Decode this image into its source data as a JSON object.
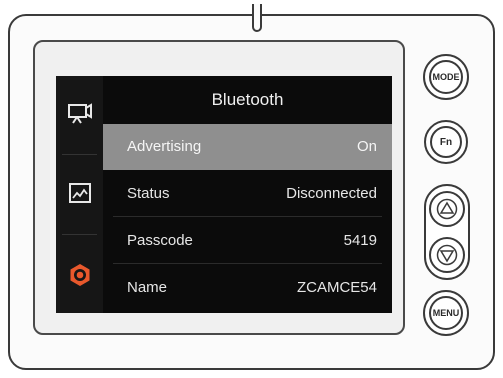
{
  "screen": {
    "title": "Bluetooth",
    "rows": [
      {
        "label": "Advertising",
        "value": "On",
        "selected": true
      },
      {
        "label": "Status",
        "value": "Disconnected",
        "selected": false
      },
      {
        "label": "Passcode",
        "value": "5419",
        "selected": false
      },
      {
        "label": "Name",
        "value": "ZCAMCE54",
        "selected": false
      }
    ]
  },
  "sidebar": {
    "icons": [
      "video-camera-icon",
      "image-adjust-icon",
      "settings-gear-icon"
    ],
    "active_color": "#e8582c"
  },
  "buttons": {
    "mode_label": "MODE",
    "fn_label": "Fn",
    "menu_label": "MENU"
  },
  "colors": {
    "lcd_background": "#0b0b0b",
    "selected_row": "#8f8f8f",
    "accent": "#e8582c"
  }
}
